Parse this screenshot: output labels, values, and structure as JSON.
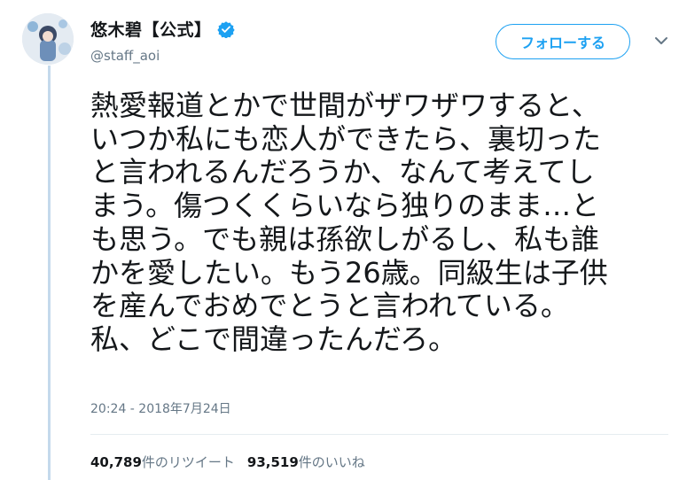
{
  "colors": {
    "accent": "#1da1f2",
    "muted": "#657786",
    "text": "#14171a",
    "thread": "#c4d9ec"
  },
  "user": {
    "display_name": "悠木碧【公式】",
    "handle": "@staff_aoi",
    "verified_icon": "verified-badge-icon",
    "avatar_icon": "avatar"
  },
  "actions": {
    "follow_label": "フォローする",
    "menu_icon": "chevron-down-icon"
  },
  "tweet": {
    "text": "熱愛報道とかで世間がザワザワすると、\nいつか私にも恋人ができたら、裏切った\nと言われるんだろうか、なんて考えてし\nまう。傷つくくらいなら独りのまま…と\nも思う。でも親は孫欲しがるし、私も誰\nかを愛したい。もう26歳。同級生は子供\nを産んでおめでとうと言われている。\n私、どこで間違ったんだろ。",
    "timestamp": "20:24 - 2018年7月24日"
  },
  "stats": {
    "retweets_count": "40,789",
    "retweets_label": "件のリツイート",
    "likes_count": "93,519",
    "likes_label": "件のいいね"
  }
}
